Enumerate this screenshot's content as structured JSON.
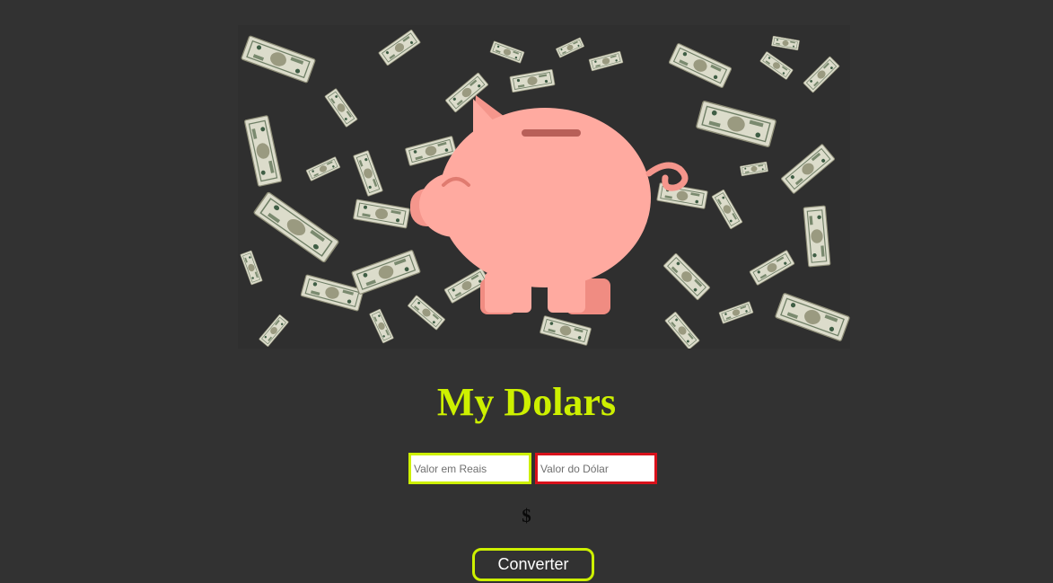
{
  "hero": {
    "illustration": "piggy-bank-with-falling-dollar-bills",
    "colors": {
      "pig": "#ffaaa0",
      "pig_shade": "#f08c82",
      "slot": "#b85f58",
      "bill": "#d9d9c4",
      "bill_ink": "#3f5e45"
    }
  },
  "header": {
    "title": "My Dolars"
  },
  "form": {
    "real_input": {
      "placeholder": "Valor em Reais",
      "value": ""
    },
    "dolar_input": {
      "placeholder": "Valor do Dólar",
      "value": ""
    }
  },
  "result": {
    "text": "$"
  },
  "actions": {
    "convert_label": "Converter"
  },
  "theme": {
    "background": "#323232",
    "accent": "#cdf000",
    "error": "#d8111b"
  }
}
